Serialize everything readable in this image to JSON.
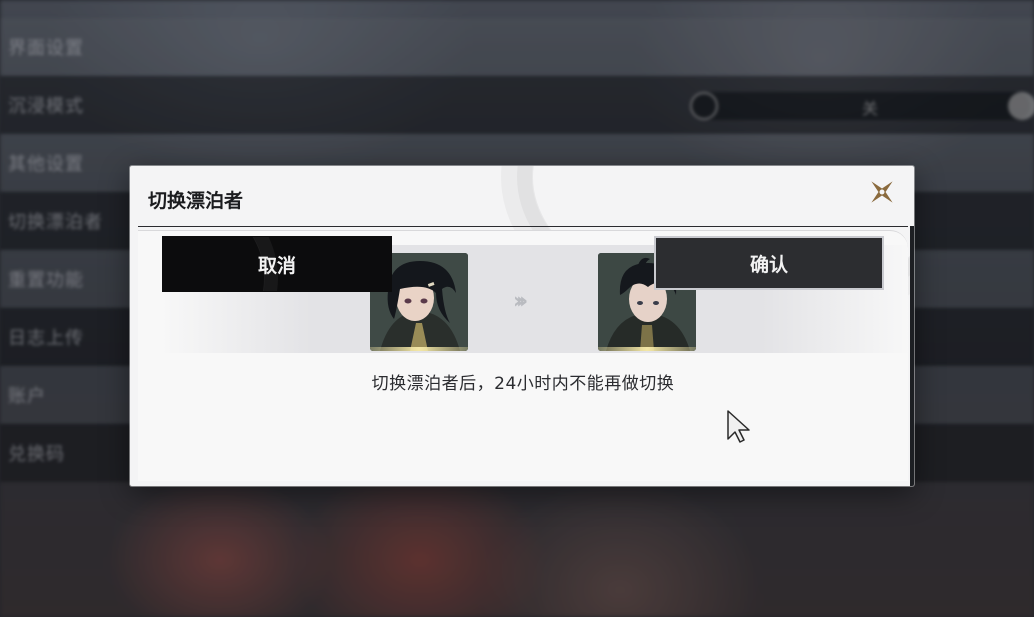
{
  "background_settings": {
    "rows": [
      {
        "label": "界面设置"
      },
      {
        "label": "沉浸模式",
        "value": "关"
      },
      {
        "label": "其他设置"
      },
      {
        "label": "切换漂泊者"
      },
      {
        "label": "重置功能"
      },
      {
        "label": "日志上传"
      },
      {
        "label": "账户"
      },
      {
        "label": "兑换码"
      }
    ]
  },
  "dialog": {
    "title": "切换漂泊者",
    "from_avatar": "female-rover-portrait",
    "to_avatar": "male-rover-portrait",
    "arrow_icon": "triple-chevron-right-icon",
    "close_icon": "star-close-icon",
    "notice": "切换漂泊者后，24小时内不能再做切换",
    "cancel_label": "取消",
    "confirm_label": "确认"
  },
  "colors": {
    "dialog_bg": "#f4f4f5",
    "cancel_bg": "#0c0c0d",
    "confirm_bg": "#2c2d30",
    "accent_gold": "#f3e7a6",
    "close_icon": "#8a6a3d"
  }
}
